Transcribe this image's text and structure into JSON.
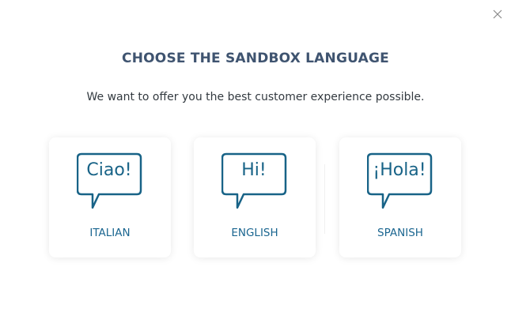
{
  "modal": {
    "title": "CHOOSE THE SANDBOX LANGUAGE",
    "subtitle": "We want to offer you the best customer experience possible.",
    "close_icon": "close-icon"
  },
  "languages": [
    {
      "greeting": "Ciao!",
      "label": "ITALIAN",
      "icon": "speech-bubble-icon"
    },
    {
      "greeting": "Hi!",
      "label": "ENGLISH",
      "icon": "speech-bubble-icon"
    },
    {
      "greeting": "¡Hola!",
      "label": "SPANISH",
      "icon": "speech-bubble-icon"
    }
  ],
  "colors": {
    "title": "#3f5470",
    "accent": "#186387",
    "card_background": "#ffffff"
  }
}
